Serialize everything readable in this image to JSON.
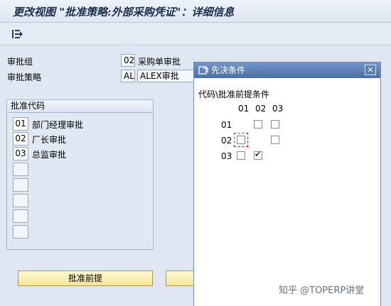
{
  "window": {
    "title": "更改视图 \"批准策略:外部采购凭证\"：详细信息"
  },
  "toolbar": {
    "icon": "table-return-icon"
  },
  "header_fields": {
    "group_label": "审批组",
    "group_code": "02",
    "group_desc": "采购单审批",
    "strategy_label": "审批策略",
    "strategy_code": "AL",
    "strategy_desc": "ALEX审批"
  },
  "release_panel": {
    "title": "批准代码",
    "rows": [
      {
        "code": "01",
        "desc": "部门经理审批"
      },
      {
        "code": "02",
        "desc": "厂长审批"
      },
      {
        "code": "03",
        "desc": "总监审批"
      }
    ]
  },
  "buttons": {
    "prerequisites": "批准前提"
  },
  "dialog": {
    "title": "先决条件",
    "close": "✕",
    "header_label": "代码\\批准前提条件",
    "columns": [
      "01",
      "02",
      "03"
    ],
    "rows": [
      {
        "code": "01",
        "checks": [
          null,
          false,
          false
        ]
      },
      {
        "code": "02",
        "checks": [
          false,
          null,
          false
        ]
      },
      {
        "code": "03",
        "checks": [
          false,
          true,
          null
        ]
      }
    ]
  },
  "watermark": "知乎 @TOPERP讲堂"
}
